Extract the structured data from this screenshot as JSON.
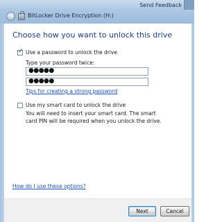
{
  "window": {
    "title": "BitLocker Drive Encryption (H:)",
    "send_feedback": "Send Feedback"
  },
  "content": {
    "heading": "Choose how you want to unlock this drive",
    "password_option": {
      "label": "Use a password to unlock the drive",
      "checked": true,
      "type_twice_label": "Type your password twice:",
      "password_value": "●●●●●",
      "confirm_value": "●●●●●",
      "tips_link": "Tips for creating a strong password"
    },
    "smartcard_option": {
      "label": "Use my smart card to unlock the drive",
      "checked": false,
      "description": "You will need to insert your smart card. The smart card PIN will be required when you unlock the drive."
    },
    "help_link": "How do I use these options?"
  },
  "buttons": {
    "next": "Next",
    "cancel": "Cancel"
  }
}
